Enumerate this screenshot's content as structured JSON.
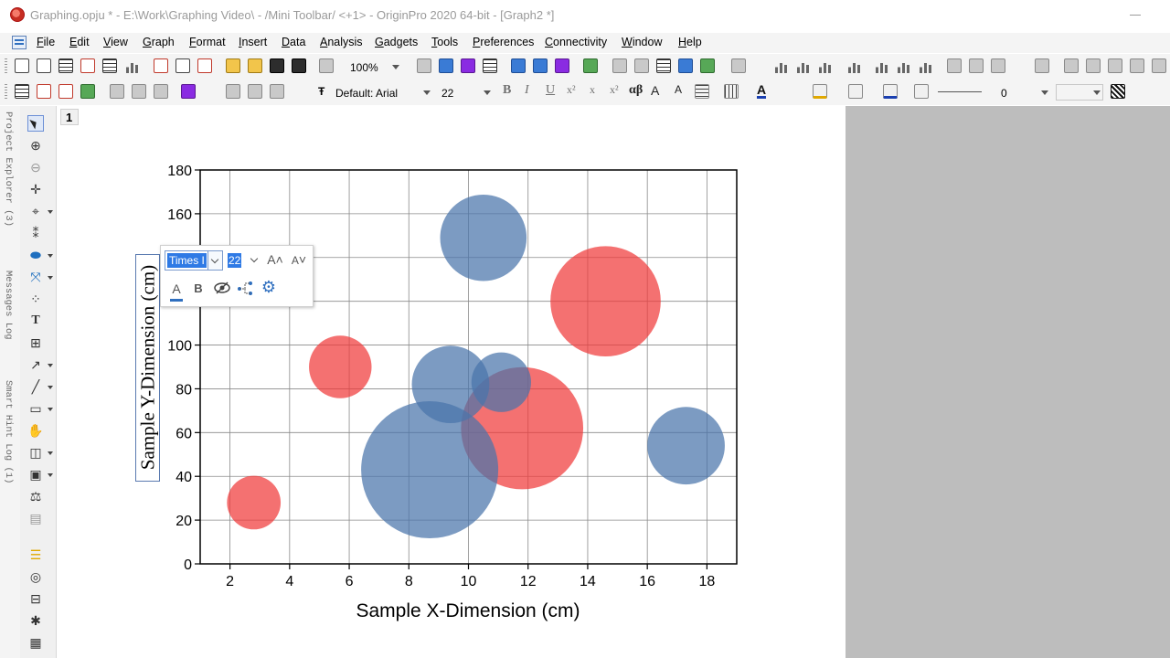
{
  "window": {
    "title": "Graphing.opju * - E:\\Work\\Graphing Video\\ - /Mini Toolbar/ <+1> - OriginPro 2020 64-bit - [Graph2 *]"
  },
  "menu": {
    "items": [
      "File",
      "Edit",
      "View",
      "Graph",
      "Format",
      "Insert",
      "Data",
      "Analysis",
      "Gadgets",
      "Tools",
      "Preferences",
      "Connectivity",
      "Window",
      "Help"
    ]
  },
  "toolbar1": {
    "zoom_value": "100%"
  },
  "toolbar2": {
    "font_combo": "Default: Arial",
    "font_size": "22",
    "bold": "B",
    "italic": "I",
    "underline": "U",
    "superscript": "x²",
    "subscript": "x",
    "subsup": "x²",
    "greek": "αβ",
    "grow_font": "A",
    "shrink_font": "A",
    "line_width": "0"
  },
  "dock": {
    "project_explorer": "Project Explorer (3)",
    "messages_log": "Messages Log",
    "smart_hint_log": "Smart Hint Log (1)"
  },
  "graph": {
    "page_tab": "1",
    "x_axis_label": "Sample X-Dimension (cm)",
    "y_axis_label": "Sample Y-Dimension (cm)"
  },
  "mini_toolbar": {
    "font_value": "Times I",
    "size_value": "22",
    "grow_label": "A",
    "shrink_label": "A",
    "color_label": "A",
    "bold_label": "B"
  },
  "colors": {
    "red_bubble": "#f03a3a",
    "blue_bubble": "#4a74aa",
    "gray_area": "#bdbdbd",
    "selection": "#2f7ae5"
  },
  "chart_data": {
    "type": "scatter",
    "xlim": [
      1,
      19
    ],
    "ylim": [
      0,
      180
    ],
    "x_ticks": [
      2,
      4,
      6,
      8,
      10,
      12,
      14,
      16,
      18
    ],
    "y_ticks": [
      0,
      20,
      40,
      60,
      80,
      100,
      120,
      140,
      160,
      180
    ],
    "grid": true,
    "series": [
      {
        "color": "#f03a3a",
        "points": [
          {
            "x": 2.8,
            "y": 28,
            "r": 0.9
          },
          {
            "x": 5.7,
            "y": 90,
            "r": 1.05
          },
          {
            "x": 11.8,
            "y": 62,
            "r": 2.05
          },
          {
            "x": 14.6,
            "y": 120,
            "r": 1.85
          }
        ]
      },
      {
        "color": "#4a74aa",
        "points": [
          {
            "x": 8.7,
            "y": 43,
            "r": 2.3
          },
          {
            "x": 9.4,
            "y": 82,
            "r": 1.3
          },
          {
            "x": 11.1,
            "y": 83,
            "r": 1.0
          },
          {
            "x": 10.5,
            "y": 149,
            "r": 1.45
          },
          {
            "x": 17.3,
            "y": 54,
            "r": 1.3
          }
        ]
      }
    ]
  }
}
